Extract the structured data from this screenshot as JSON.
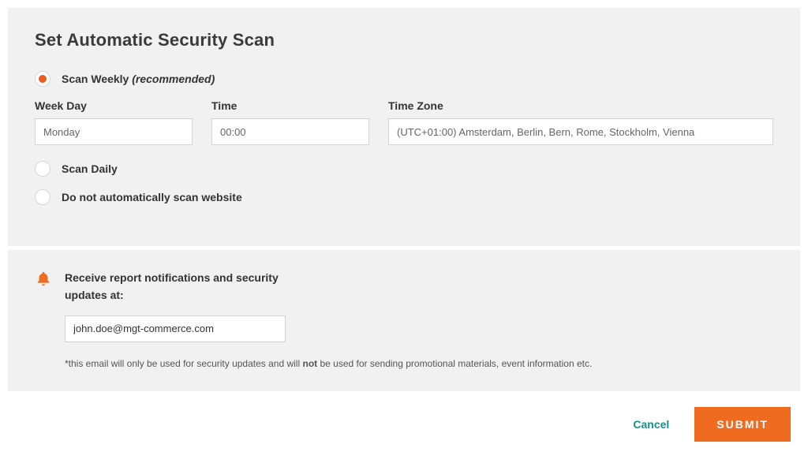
{
  "scan_panel": {
    "heading": "Set Automatic Security Scan",
    "option_weekly_label": "Scan Weekly ",
    "option_weekly_hint": "(recommended)",
    "option_daily_label": "Scan Daily",
    "option_none_label": "Do not automatically scan website",
    "weekday_label": "Week Day",
    "weekday_value": "Monday",
    "time_label": "Time",
    "time_value": "00:00",
    "tz_label": "Time Zone",
    "tz_value": "(UTC+01:00) Amsterdam, Berlin, Bern, Rome, Stockholm, Vienna"
  },
  "notify_panel": {
    "title": "Receive report notifications and security updates at:",
    "email_value": "john.doe@mgt-commerce.com",
    "disclaimer_pre": "*this email will only be used for security updates and will ",
    "disclaimer_bold": "not",
    "disclaimer_post": " be used for sending promotional materials, event information etc."
  },
  "actions": {
    "cancel": "Cancel",
    "submit": "SUBMIT"
  },
  "colors": {
    "accent": "#ee6b1f",
    "teal": "#1a8f8a"
  }
}
